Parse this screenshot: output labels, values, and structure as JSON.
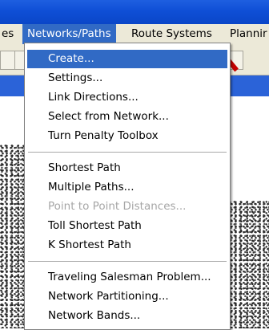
{
  "menubar": {
    "items": [
      {
        "label": "es"
      },
      {
        "label": "Networks/Paths"
      },
      {
        "label": "Route Systems"
      },
      {
        "label": "Plannir"
      }
    ]
  },
  "dropdown": {
    "items": [
      {
        "label": "Create..."
      },
      {
        "label": "Settings..."
      },
      {
        "label": "Link Directions..."
      },
      {
        "label": "Select from Network..."
      },
      {
        "label": "Turn Penalty Toolbox"
      },
      {
        "label": "Shortest Path"
      },
      {
        "label": "Multiple Paths..."
      },
      {
        "label": "Point to Point Distances..."
      },
      {
        "label": "Toll Shortest Path"
      },
      {
        "label": "K Shortest Path"
      },
      {
        "label": "Traveling Salesman Problem..."
      },
      {
        "label": "Network Partitioning..."
      },
      {
        "label": "Network Bands..."
      }
    ]
  },
  "colors": {
    "highlight": "#316ac5",
    "disabled_text": "#a6a6a6",
    "titlebar": "#0f4fd6",
    "menubar_bg": "#ece9d8"
  }
}
